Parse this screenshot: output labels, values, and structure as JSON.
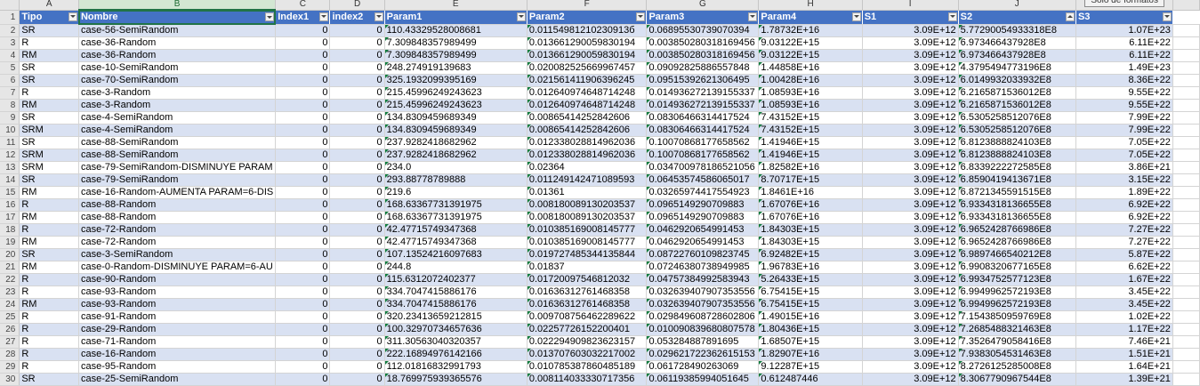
{
  "sheet": {
    "columns": [
      "A",
      "B",
      "C",
      "D",
      "E",
      "F",
      "G",
      "H",
      "I",
      "J",
      "K"
    ],
    "headers": [
      "Tipo",
      "Nombre",
      "Index1",
      "index2",
      "Param1",
      "Param2",
      "Param3",
      "Param4",
      "S1",
      "S2",
      "S3"
    ],
    "rows": [
      {
        "n": "2",
        "c": [
          "SR",
          "case-56-SemiRandom",
          "0",
          "0",
          "110.43329528008681",
          "0.01154981210230913б",
          "0.06895530739070394",
          "1.78732E+16",
          "3.09E+12",
          "5.77290054933318E8",
          "1.07E+23"
        ]
      },
      {
        "n": "3",
        "c": [
          "R",
          "case-36-Random",
          "0",
          "0",
          "7.309848357989499",
          "0.01366129005983019​4",
          "0.003850280318169456",
          "9.03122E+15",
          "3.09E+12",
          "6.973466437928E8",
          "6.11E+22"
        ]
      },
      {
        "n": "4",
        "c": [
          "RM",
          "case-36-Random",
          "0",
          "0",
          "7.309848357989499",
          "0.013661290059830194",
          "0.003850280318169456",
          "9.03122E+15",
          "3.09E+12",
          "6.973466437928E8",
          "6.11E+22"
        ]
      },
      {
        "n": "5",
        "c": [
          "SR",
          "case-10-SemiRandom",
          "0",
          "0",
          "248.274919139683",
          "0.020082525669967457",
          "0.09092825886557848",
          "1.44858E+16",
          "3.09E+12",
          "4.3795494773196E8",
          "1.49E+23"
        ]
      },
      {
        "n": "6",
        "c": [
          "SR",
          "case-70-SemiRandom",
          "0",
          "0",
          "325.1932099395169",
          "0.021561411906396245",
          "0.0951539262130649​5",
          "1.00428E+16",
          "3.09E+12",
          "6.0149932033932E8",
          "8.36E+22"
        ]
      },
      {
        "n": "7",
        "c": [
          "R",
          "case-3-Random",
          "0",
          "0",
          "215.45996249243623",
          "0.012640974648714248",
          "0.014936272139155337",
          "1.08593E+16",
          "3.09E+12",
          "6.2165871536012E8",
          "9.55E+22"
        ]
      },
      {
        "n": "8",
        "c": [
          "RM",
          "case-3-Random",
          "0",
          "0",
          "215.45996249243623",
          "0.012640974648714248",
          "0.014936272139155337",
          "1.08593E+16",
          "3.09E+12",
          "6.2165871536012E8",
          "9.55E+22"
        ]
      },
      {
        "n": "9",
        "c": [
          "SR",
          "case-4-SemiRandom",
          "0",
          "0",
          "134.8309459689349",
          "0.008654142528426​06",
          "0.08306466314417524",
          "7.43152E+15",
          "3.09E+12",
          "6.5305258512076E8",
          "7.99E+22"
        ]
      },
      {
        "n": "10",
        "c": [
          "SRM",
          "case-4-SemiRandom",
          "0",
          "0",
          "134.8309459689349",
          "0.00865414252842606",
          "0.08306466314417524",
          "7.43152E+15",
          "3.09E+12",
          "6.5305258512076E8",
          "7.99E+22"
        ]
      },
      {
        "n": "11",
        "c": [
          "SR",
          "case-88-SemiRandom",
          "0",
          "0",
          "237.9282418682962",
          "0.012338028814962036",
          "0.1007086817765856​2",
          "1.41946E+15",
          "3.09E+12",
          "6.8123888824103E8",
          "7.05E+22"
        ]
      },
      {
        "n": "12",
        "c": [
          "SRM",
          "case-88-SemiRandom",
          "0",
          "0",
          "237.9282418682962",
          "0.012338028814962036",
          "0.10070868177658562",
          "1.41946E+15",
          "3.09E+12",
          "6.8123888824103E8",
          "7.05E+22"
        ]
      },
      {
        "n": "13",
        "c": [
          "SRM",
          "case-79-SemiRandom-DISMINUYE PARAM",
          "0",
          "0",
          "234.0",
          "0.02364",
          "0.03470097818652105​6",
          "1.82582E+16",
          "3.09E+12",
          "6.8339222272585E8",
          "3.86E+21"
        ]
      },
      {
        "n": "14",
        "c": [
          "SR",
          "case-79-SemiRandom",
          "0",
          "0",
          "293.8877878988​8",
          "0.011249142471089593",
          "0.06453574586065017",
          "8.70717E+15",
          "3.09E+12",
          "6.8590419413671E8",
          "3.15E+22"
        ]
      },
      {
        "n": "15",
        "c": [
          "RM",
          "case-16-Random-AUMENTA PARAM=6-DIS",
          "0",
          "0",
          "219.6",
          "0.01361",
          "0.03265974417554923",
          "1.8461E+16",
          "3.09E+12",
          "6.8721345591515E8",
          "1.89E+22"
        ]
      },
      {
        "n": "16",
        "c": [
          "R",
          "case-88-Random",
          "0",
          "0",
          "168.63367731391975",
          "0.008180089130203537",
          "0.0965149290709883",
          "1.67076E+16",
          "3.09E+12",
          "6.9334318136655E8",
          "6.92E+22"
        ]
      },
      {
        "n": "17",
        "c": [
          "RM",
          "case-88-Random",
          "0",
          "0",
          "168.63367731391975",
          "0.008180089130203537",
          "0.0965149290709883",
          "1.67076E+16",
          "3.09E+12",
          "6.9334318136655E8",
          "6.92E+22"
        ]
      },
      {
        "n": "18",
        "c": [
          "R",
          "case-72-Random",
          "0",
          "0",
          "42.47715749347368",
          "0.010385169008145777",
          "0.0462920654991453",
          "1.84303E+15",
          "3.09E+12",
          "6.9652428766986E8",
          "7.27E+22"
        ]
      },
      {
        "n": "19",
        "c": [
          "RM",
          "case-72-Random",
          "0",
          "0",
          "42.47715749347368",
          "0.010385169008145777",
          "0.0462920654991453",
          "1.84303E+15",
          "3.09E+12",
          "6.9652428766986E8",
          "7.27E+22"
        ]
      },
      {
        "n": "20",
        "c": [
          "SR",
          "case-3-SemiRandom",
          "0",
          "0",
          "107.13524216097683",
          "0.019727485344135844",
          "0.08722760109823745",
          "6.92482E+15",
          "3.09E+12",
          "6.9897466540212E8",
          "5.87E+22"
        ]
      },
      {
        "n": "21",
        "c": [
          "RM",
          "case-0-Random-DISMINUYE PARAM=6-AU",
          "0",
          "0",
          "244.8",
          "0.01837",
          "0.07246380738949985",
          "1.96783E+16",
          "3.09E+12",
          "6.9908320677165E8",
          "6.62E+22"
        ]
      },
      {
        "n": "22",
        "c": [
          "R",
          "case-90-Random",
          "0",
          "0",
          "115.6312072402377",
          "0.01720097546812032",
          "0.04757384992583943",
          "5.26433E+15",
          "3.09E+12",
          "6.9934752577123E8",
          "1.67E+22"
        ]
      },
      {
        "n": "23",
        "c": [
          "R",
          "case-93-Random",
          "0",
          "0",
          "334.7047415886176",
          "0.016363127614683​58",
          "0.03263940790735355​6",
          "6.75415E+15",
          "3.09E+12",
          "6.9949962572193E8",
          "3.45E+22"
        ]
      },
      {
        "n": "24",
        "c": [
          "RM",
          "case-93-Random",
          "0",
          "0",
          "334.7047415886176",
          "0.01636312761468358",
          "0.032639407907353556",
          "6.75415E+15",
          "3.09E+12",
          "6.9949962572193E8",
          "3.45E+22"
        ]
      },
      {
        "n": "25",
        "c": [
          "R",
          "case-91-Random",
          "0",
          "0",
          "320.23413659212815",
          "0.009708756462289622",
          "0.029849608728602806",
          "1.49015E+16",
          "3.09E+12",
          "7.1543850959769E8",
          "1.02E+22"
        ]
      },
      {
        "n": "26",
        "c": [
          "R",
          "case-29-Random",
          "0",
          "0",
          "100.32970734657636",
          "0.022577261522004​01",
          "0.010090839680807578",
          "1.80436E+15",
          "3.09E+12",
          "7.2685488321463E8",
          "1.17E+22"
        ]
      },
      {
        "n": "27",
        "c": [
          "R",
          "case-71-Random",
          "0",
          "0",
          "311.30563040320357",
          "0.022294909823623157",
          "0.05328488789​1695",
          "1.68507E+15",
          "3.09E+12",
          "7.3526479058416E8",
          "7.46E+21"
        ]
      },
      {
        "n": "28",
        "c": [
          "R",
          "case-16-Random",
          "0",
          "0",
          "222.16894976142166",
          "0.013707603032217002",
          "0.029621722362615153",
          "1.82907E+16",
          "3.09E+12",
          "7.9383054531463E8",
          "1.51E+21"
        ]
      },
      {
        "n": "29",
        "c": [
          "R",
          "case-95-Random",
          "0",
          "0",
          "112.01816832991793",
          "0.010785387860485189",
          "0.06172849026306​9",
          "9.12287E+15",
          "3.09E+12",
          "8.2726125285008E8",
          "1.64E+21"
        ]
      },
      {
        "n": "30",
        "c": [
          "SR",
          "case-25-SemiRandom",
          "0",
          "0",
          "18.769975939365576",
          "0.0081140333307173​56",
          "0.0611938599​4051645",
          "0.612487446",
          "3.09E+12",
          "8.3067790967544E8",
          "1.39E+21"
        ]
      }
    ]
  },
  "tooltip": "Solo de formatos"
}
